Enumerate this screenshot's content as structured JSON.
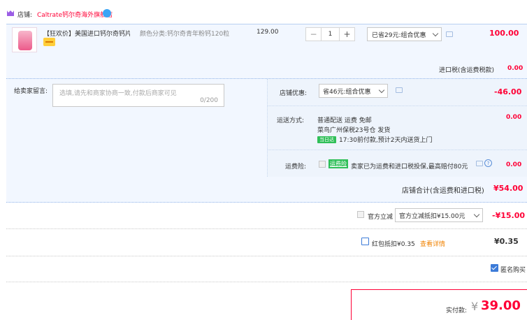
{
  "store": {
    "label": "店铺:",
    "name": "Caltrate钙尔奇海外旗舰店"
  },
  "item": {
    "title": "【狂欢价】美国进口钙尔奇钙片...",
    "sku": "颜色分类:钙尔奇青年粉钙120粒",
    "unit_price": "129.00",
    "qty_minus": "−",
    "qty_value": "1",
    "qty_plus": "+",
    "promo": "已省29元:组合优惠",
    "total": "100.00"
  },
  "tax": {
    "label": "进口税(含运费税款)",
    "value": "0.00"
  },
  "message": {
    "label": "给卖家留言:",
    "placeholder": "选填,请先和商家协商一致,付款后商家可见",
    "count": "0/200"
  },
  "shop_promo": {
    "label": "店铺优惠:",
    "select": "省46元:组合优惠",
    "value": "-46.00"
  },
  "shipping": {
    "label": "运送方式:",
    "line1": "普通配送 运费 免邮",
    "line2": "菜鸟广州保税23号仓  发货",
    "badge": "当日达",
    "line3": "17:30前付款,预计2天内送货上门",
    "value": "0.00"
  },
  "insurance": {
    "label": "运费险:",
    "badge": "运费险",
    "text": "卖家已为运费和进口税投保,最高赔付80元",
    "help": "?",
    "value": "0.00"
  },
  "store_total": {
    "label": "店铺合计(含运费和进口税)",
    "value": "¥54.00"
  },
  "tmall_discount": {
    "label": "官方立减",
    "select": "官方立减抵扣¥15.00元",
    "value": "-¥15.00"
  },
  "red_packet": {
    "label": "红包抵扣¥0.35",
    "link": "查看详情",
    "value": "¥0.35"
  },
  "anonymous": {
    "label": "匿名购买",
    "checked": true
  },
  "pay": {
    "label": "实付款:",
    "currency": "¥",
    "amount": "39.00"
  },
  "colors": {
    "accent": "#ff0036",
    "panel": "#f2f7ff",
    "link": "#3c7bd8"
  }
}
